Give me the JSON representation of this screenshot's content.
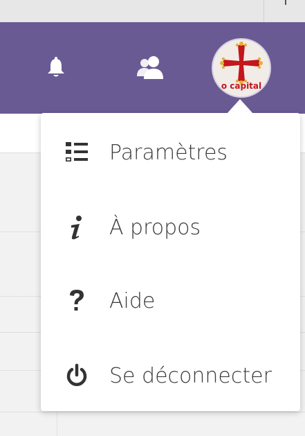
{
  "header": {
    "notifications_icon": "bell-icon",
    "contacts_icon": "contacts-icon",
    "avatar_logo_text": "o capital",
    "colors": {
      "header_bg": "#6a5a93",
      "avatar_cross": "#c4161c",
      "avatar_accent": "#e0b13a"
    }
  },
  "menu": {
    "items": [
      {
        "label": "Paramètres",
        "icon": "list-settings-icon"
      },
      {
        "label": "À propos",
        "icon": "info-icon"
      },
      {
        "label": "Aide",
        "icon": "question-icon"
      },
      {
        "label": "Se déconnecter",
        "icon": "power-icon"
      }
    ]
  }
}
